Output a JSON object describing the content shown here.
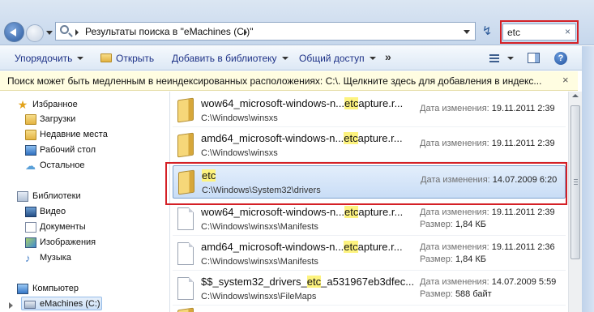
{
  "window": {
    "title": "Результаты поиска в \"eMachines (C:)\"",
    "close_glyph": "x"
  },
  "addressbar": {
    "crumb": "Результаты поиска в \"eMachines (C:)\"",
    "search_value": "etc",
    "search_clear_glyph": "×",
    "refresh_glyph": "↯"
  },
  "toolbar": {
    "organize": "Упорядочить",
    "open": "Открыть",
    "add_to_library": "Добавить в библиотеку",
    "share": "Общий доступ",
    "more": "»",
    "help": "?"
  },
  "infobar": {
    "text": "Поиск может быть медленным в неиндексированных расположениях: C:\\. Щелкните здесь для добавления в индекс...",
    "close": "×"
  },
  "nav": {
    "favorites": "Избранное",
    "downloads": "Загрузки",
    "recent": "Недавние места",
    "desktop": "Рабочий стол",
    "other": "Остальное",
    "libraries": "Библиотеки",
    "video": "Видео",
    "documents": "Документы",
    "images": "Изображения",
    "music": "Музыка",
    "computer": "Компьютер",
    "drive": "eMachines (C:)"
  },
  "results": [
    {
      "name_pre": "wow64_microsoft-windows-n...",
      "name_hl": "etc",
      "name_post": "apture.r...",
      "path": "C:\\Windows\\winsxs",
      "meta1_key": "Дата изменения:",
      "meta1_val": "19.11.2011 2:39",
      "meta2_key": "",
      "meta2_val": "",
      "icon": "folder-icon"
    },
    {
      "name_pre": "amd64_microsoft-windows-n...",
      "name_hl": "etc",
      "name_post": "apture.r...",
      "path": "C:\\Windows\\winsxs",
      "meta1_key": "Дата изменения:",
      "meta1_val": "19.11.2011 2:39",
      "meta2_key": "",
      "meta2_val": "",
      "icon": "folder-icon"
    },
    {
      "name_pre": "",
      "name_hl": "etc",
      "name_post": "",
      "path": "C:\\Windows\\System32\\drivers",
      "meta1_key": "Дата изменения:",
      "meta1_val": "14.07.2009 6:20",
      "meta2_key": "",
      "meta2_val": "",
      "icon": "folder-icon"
    },
    {
      "name_pre": "wow64_microsoft-windows-n...",
      "name_hl": "etc",
      "name_post": "apture.r...",
      "path": "C:\\Windows\\winsxs\\Manifests",
      "meta1_key": "Дата изменения:",
      "meta1_val": "19.11.2011 2:39",
      "meta2_key": "Размер:",
      "meta2_val": "1,84 КБ",
      "icon": "file-icon"
    },
    {
      "name_pre": "amd64_microsoft-windows-n...",
      "name_hl": "etc",
      "name_post": "apture.r...",
      "path": "C:\\Windows\\winsxs\\Manifests",
      "meta1_key": "Дата изменения:",
      "meta1_val": "19.11.2011 2:36",
      "meta2_key": "Размер:",
      "meta2_val": "1,84 КБ",
      "icon": "file-icon"
    },
    {
      "name_pre": "$$_system32_drivers_",
      "name_hl": "etc",
      "name_post": "_a531967eb3dfec...",
      "path": "C:\\Windows\\winsxs\\FileMaps",
      "meta1_key": "Дата изменения:",
      "meta1_val": "14.07.2009 5:59",
      "meta2_key": "Размер:",
      "meta2_val": "588 байт",
      "icon": "file-icon"
    }
  ],
  "colors": {
    "highlight_frame": "#d42026",
    "search_highlight": "#fdf37f",
    "selection": "#c9ddf6"
  }
}
